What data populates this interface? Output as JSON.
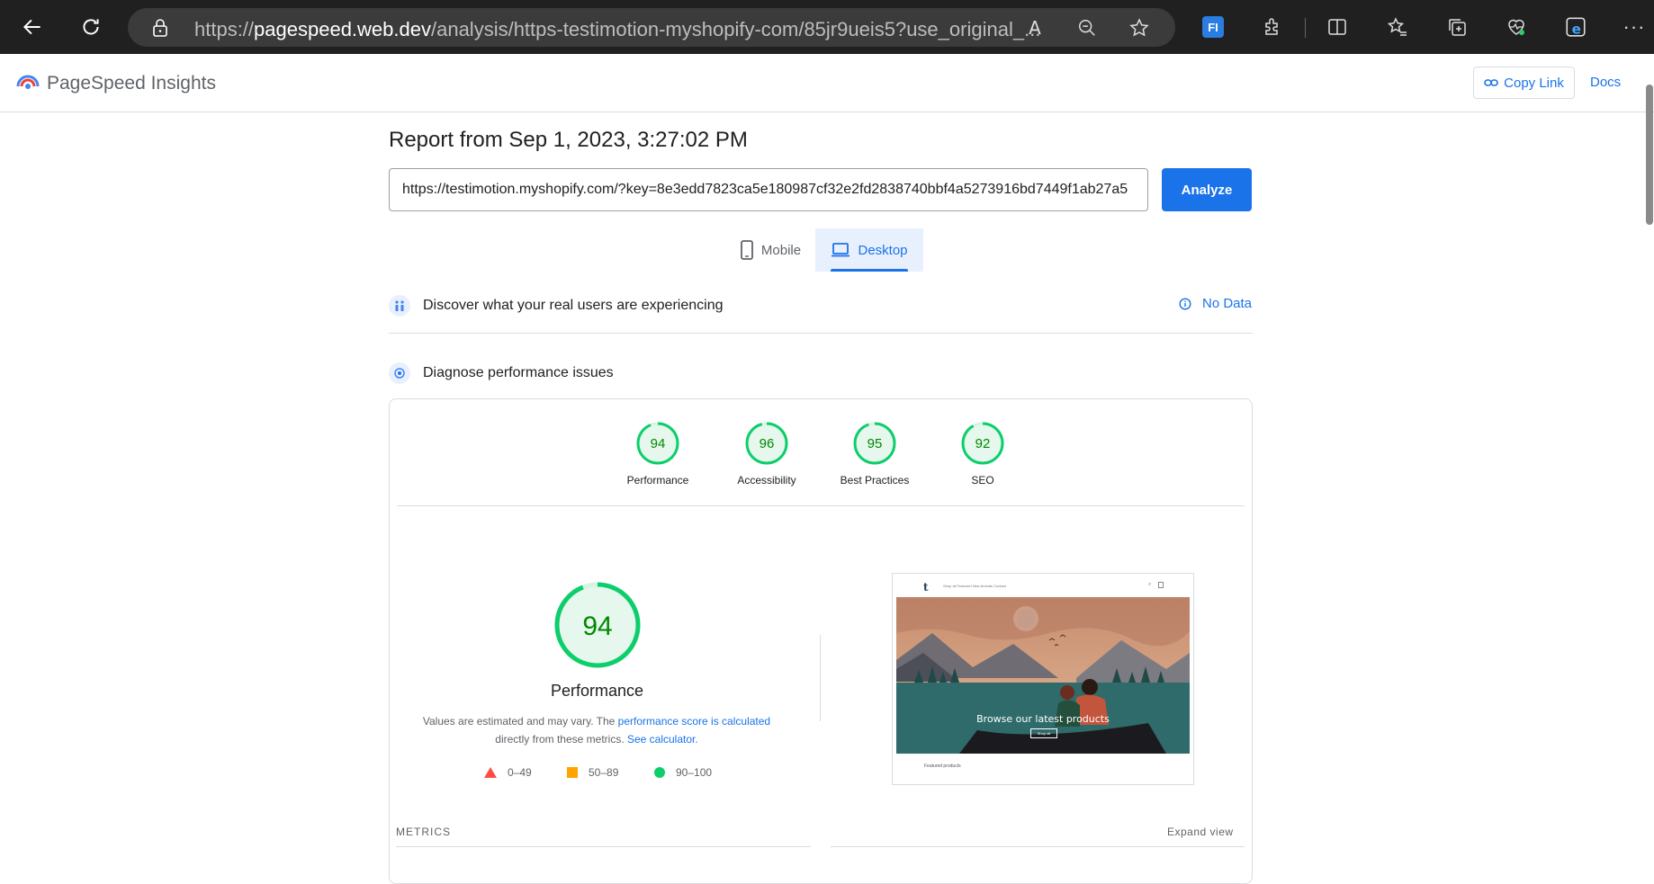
{
  "browser": {
    "url_prefix": "https://",
    "url_domain": "pagespeed.web.dev",
    "url_rest": "/analysis/https-testimotion-myshopify-com/85jr9ueis5?use_original_..."
  },
  "header": {
    "brand": "PageSpeed Insights",
    "copy_link": "Copy Link",
    "docs": "Docs"
  },
  "report": {
    "title": "Report from Sep 1, 2023, 3:27:02 PM",
    "url_value": "https://testimotion.myshopify.com/?key=8e3edd7823ca5e180987cf32e2fd2838740bbf4a5273916bd7449f1ab27a5",
    "analyze_label": "Analyze"
  },
  "tabs": {
    "mobile": "Mobile",
    "desktop": "Desktop"
  },
  "sections": {
    "real_users": "Discover what your real users are experiencing",
    "no_data": "No Data",
    "diagnose": "Diagnose performance issues"
  },
  "scores": [
    {
      "value": "94",
      "label": "Performance",
      "fraction": 0.94
    },
    {
      "value": "96",
      "label": "Accessibility",
      "fraction": 0.96
    },
    {
      "value": "95",
      "label": "Best Practices",
      "fraction": 0.95
    },
    {
      "value": "92",
      "label": "SEO",
      "fraction": 0.92
    }
  ],
  "performance": {
    "score": "94",
    "fraction": 0.94,
    "title": "Performance",
    "note_prefix": "Values are estimated and may vary. The ",
    "note_link1": "performance score is calculated",
    "note_middle": " directly from these metrics. ",
    "note_link2": "See calculator."
  },
  "legend": [
    {
      "range": "0–49",
      "shape": "triangle",
      "color": "#ff4e42"
    },
    {
      "range": "50–89",
      "shape": "square",
      "color": "#ffa400"
    },
    {
      "range": "90–100",
      "shape": "circle",
      "color": "#0cce6b"
    }
  ],
  "screenshot": {
    "caption": "Browse our latest products",
    "button": "Shop all",
    "nav_links": "Shop all  Featured  New Arrivals  Contact",
    "footer": "Featured products"
  },
  "metrics": {
    "label": "METRICS",
    "expand": "Expand view"
  },
  "colors": {
    "accent": "#1a73e8",
    "pass": "#0cce6b",
    "pass_text": "#008800",
    "pass_fill": "#e6f7ed"
  }
}
